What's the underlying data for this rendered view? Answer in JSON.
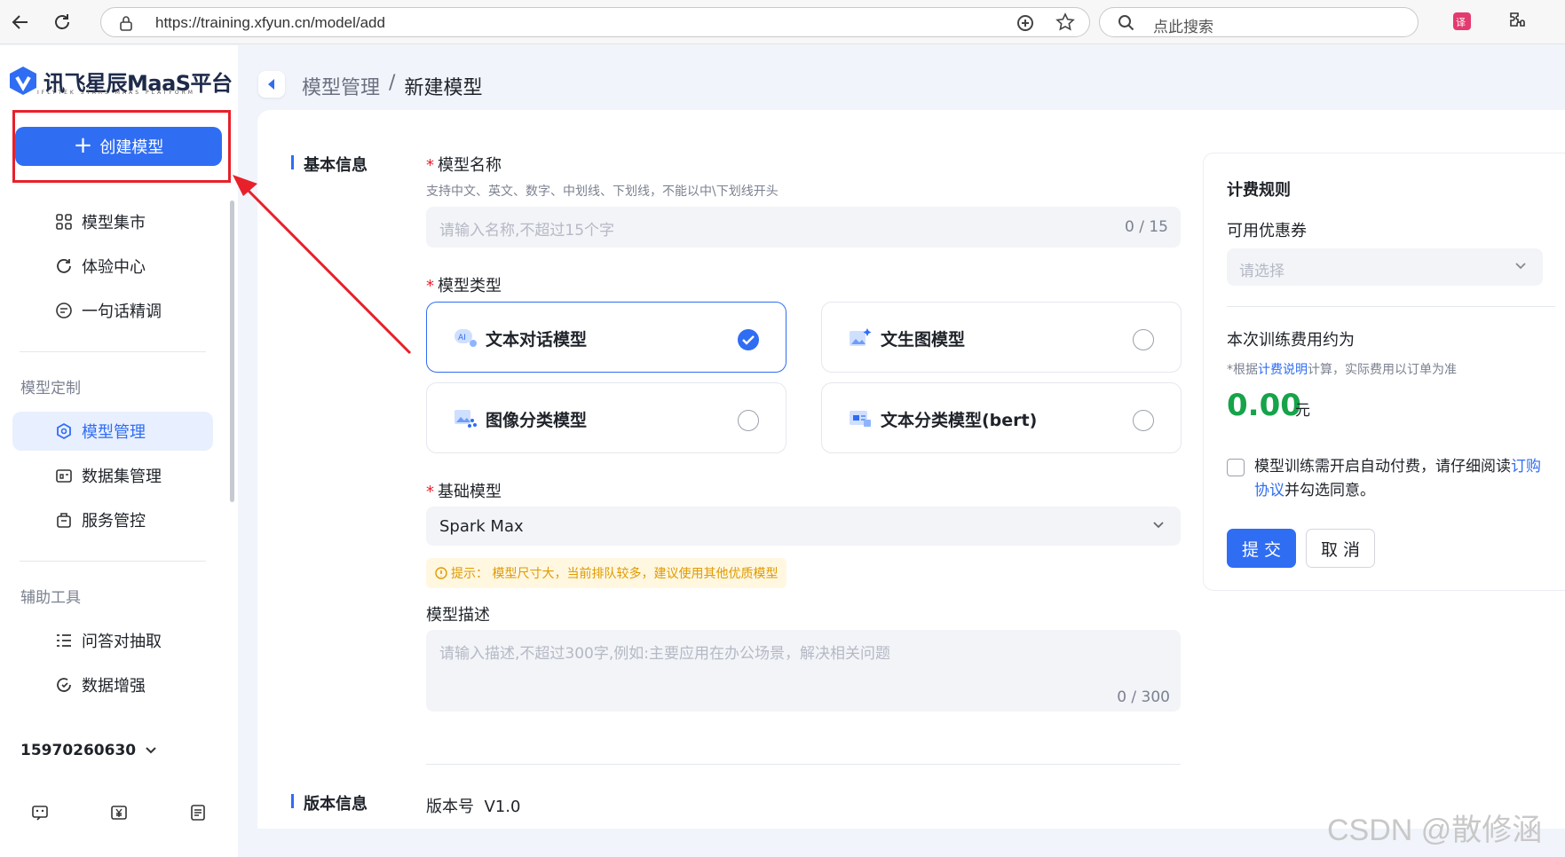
{
  "browser": {
    "url": "https://training.xfyun.cn/model/add",
    "search_placeholder": "点此搜索"
  },
  "sidebar": {
    "logo_text": "讯飞星辰MaaS平台",
    "logo_sub": "IFLYTEK STARS MAAS PLATFORM",
    "create_button": "创建模型",
    "top_items": [
      {
        "label": "模型集市",
        "icon": "grid-icon"
      },
      {
        "label": "体验中心",
        "icon": "refresh-icon"
      },
      {
        "label": "一句话精调",
        "icon": "tune-icon"
      }
    ],
    "section_custom": "模型定制",
    "custom_items": [
      {
        "label": "模型管理",
        "icon": "model-icon",
        "active": true
      },
      {
        "label": "数据集管理",
        "icon": "dataset-icon"
      },
      {
        "label": "服务管控",
        "icon": "service-icon"
      }
    ],
    "section_tools": "辅助工具",
    "tool_items": [
      {
        "label": "问答对抽取",
        "icon": "list-icon"
      },
      {
        "label": "数据增强",
        "icon": "enhance-icon"
      }
    ],
    "phone": "15970260630"
  },
  "breadcrumb": {
    "parent": "模型管理",
    "separator": "/",
    "current": "新建模型"
  },
  "basic": {
    "section_title": "基本信息",
    "name_label": "模型名称",
    "name_hint": "支持中文、英文、数字、中划线、下划线，不能以中\\下划线开头",
    "name_placeholder": "请输入名称,不超过15个字",
    "name_counter": "0 / 15",
    "type_label": "模型类型",
    "types": [
      {
        "label": "文本对话模型",
        "selected": true
      },
      {
        "label": "文生图模型",
        "selected": false
      },
      {
        "label": "图像分类模型",
        "selected": false
      },
      {
        "label": "文本分类模型(bert)",
        "selected": false
      }
    ],
    "base_label": "基础模型",
    "base_value": "Spark Max",
    "warning": "提示：  模型尺寸大，当前排队较多，建议使用其他优质模型",
    "desc_label": "模型描述",
    "desc_placeholder": "请输入描述,不超过300字,例如:主要应用在办公场景，解决相关问题",
    "desc_counter": "0 / 300"
  },
  "version": {
    "section_title": "版本信息",
    "version_label": "版本号",
    "version_value": "V1.0"
  },
  "billing": {
    "title": "计费规则",
    "coupon_label": "可用优惠券",
    "coupon_placeholder": "请选择",
    "fee_label": "本次训练费用约为",
    "note_prefix": "*根据",
    "note_link": "计费说明",
    "note_suffix": "计算，实际费用以订单为准",
    "fee_value": "0.00",
    "fee_unit": "元",
    "agree_text": "模型训练需开启自动付费，请仔细阅读",
    "agree_link": "订购协议",
    "agree_suffix": "并勾选同意。",
    "submit": "提 交",
    "cancel": "取 消"
  },
  "watermark": "CSDN @散修涵",
  "colors": {
    "primary": "#2f6df3",
    "highlight": "#e8202b",
    "fee": "#16a34a",
    "warning": "#e09a00"
  }
}
